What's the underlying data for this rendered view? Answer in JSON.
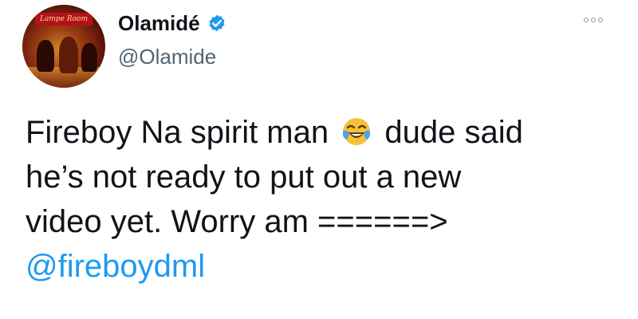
{
  "tweet": {
    "author": {
      "display_name": "Olamidé",
      "handle": "@Olamide",
      "verified": true,
      "avatar_caption": "Lampe Room"
    },
    "more_icon": "ellipsis-icon",
    "body": {
      "line1_before_emoji": "Fireboy Na spirit man",
      "emoji": "face-with-tears-of-joy",
      "line1_after_emoji": "dude said",
      "line2": "he’s not ready to put out a new",
      "line3": "video yet. Worry am ======>",
      "mention": "@fireboydml"
    },
    "colors": {
      "verified": "#1d9bf0",
      "mention": "#1d9bf0",
      "handle": "#536471"
    }
  }
}
